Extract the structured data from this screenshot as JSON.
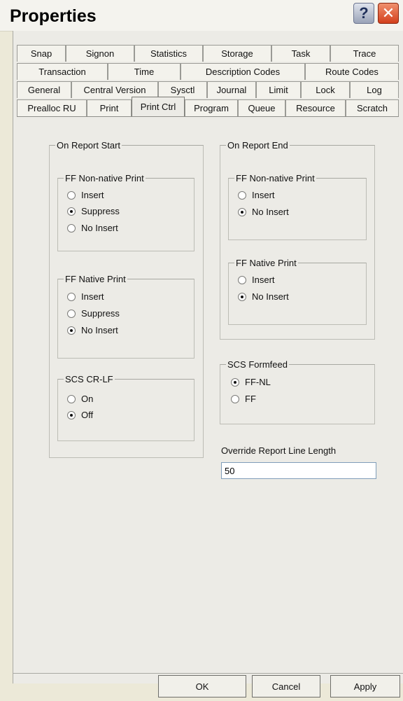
{
  "window": {
    "title": "Properties",
    "help_label": "?",
    "close_label": "✕"
  },
  "tabs": {
    "row1": [
      "Snap",
      "Signon",
      "Statistics",
      "Storage",
      "Task",
      "Trace"
    ],
    "row2": [
      "Transaction",
      "Time",
      "Description Codes",
      "Route Codes"
    ],
    "row3": [
      "General",
      "Central Version",
      "Sysctl",
      "Journal",
      "Limit",
      "Lock",
      "Log"
    ],
    "row4": [
      "Prealloc RU",
      "Print",
      "Print Ctrl",
      "Program",
      "Queue",
      "Resource",
      "Scratch"
    ],
    "active": "Print Ctrl"
  },
  "report_start": {
    "title": "On Report Start",
    "ff_non_native": {
      "title": "FF Non-native Print",
      "options": [
        "Insert",
        "Suppress",
        "No Insert"
      ],
      "selected": "Suppress"
    },
    "ff_native": {
      "title": "FF Native Print",
      "options": [
        "Insert",
        "Suppress",
        "No Insert"
      ],
      "selected": "No Insert"
    },
    "scs_crlf": {
      "title": "SCS CR-LF",
      "options": [
        "On",
        "Off"
      ],
      "selected": "Off"
    }
  },
  "report_end": {
    "title": "On Report End",
    "ff_non_native": {
      "title": "FF Non-native Print",
      "options": [
        "Insert",
        "No Insert"
      ],
      "selected": "No Insert"
    },
    "ff_native": {
      "title": "FF Native Print",
      "options": [
        "Insert",
        "No Insert"
      ],
      "selected": "No Insert"
    }
  },
  "scs_formfeed": {
    "title": "SCS Formfeed",
    "options": [
      "FF-NL",
      "FF"
    ],
    "selected": "FF-NL"
  },
  "override": {
    "label": "Override Report Line Length",
    "value": "50"
  },
  "buttons": {
    "ok": "OK",
    "cancel": "Cancel",
    "apply": "Apply"
  }
}
